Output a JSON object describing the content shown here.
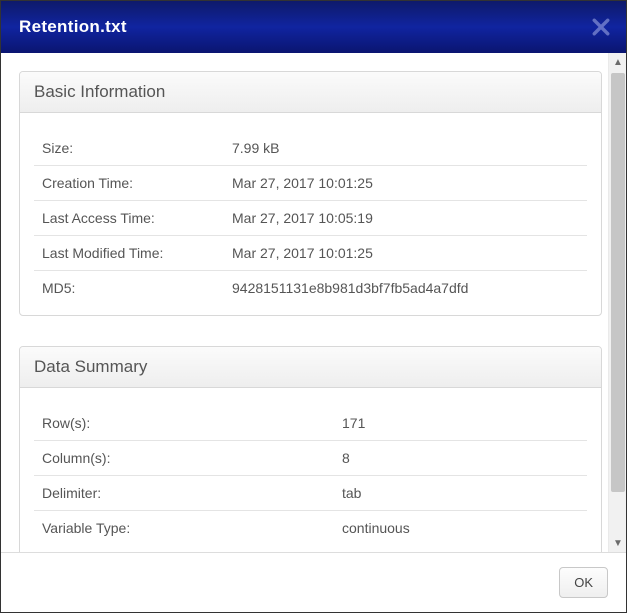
{
  "dialog": {
    "title": "Retention.txt",
    "ok_label": "OK"
  },
  "basic_info": {
    "header": "Basic Information",
    "size_label": "Size:",
    "size_value": "7.99 kB",
    "creation_label": "Creation Time:",
    "creation_value": "Mar 27, 2017 10:01:25",
    "access_label": "Last Access Time:",
    "access_value": "Mar 27, 2017 10:05:19",
    "modified_label": "Last Modified Time:",
    "modified_value": "Mar 27, 2017 10:01:25",
    "md5_label": "MD5:",
    "md5_value": "9428151131e8b981d3bf7fb5ad4a7dfd"
  },
  "data_summary": {
    "header": "Data Summary",
    "rows_label": "Row(s):",
    "rows_value": "171",
    "cols_label": "Column(s):",
    "cols_value": "8",
    "delim_label": "Delimiter:",
    "delim_value": "tab",
    "vartype_label": "Variable Type:",
    "vartype_value": "continuous"
  }
}
